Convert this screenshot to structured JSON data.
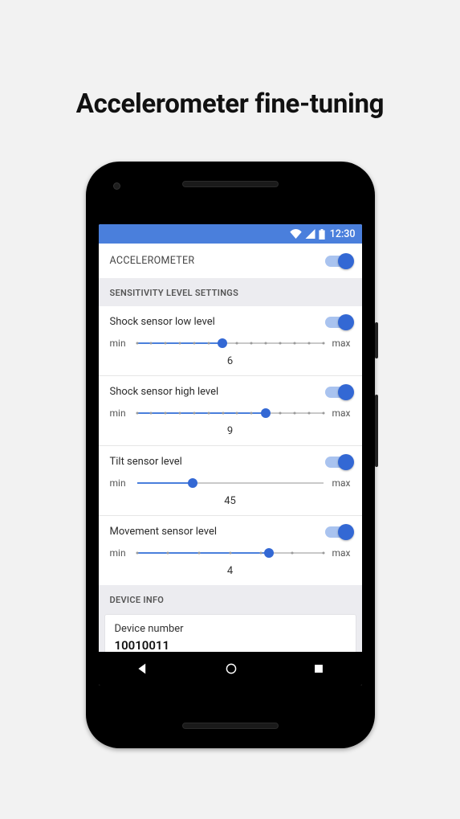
{
  "page": {
    "title": "Accelerometer fine-tuning"
  },
  "status": {
    "time": "12:30"
  },
  "master": {
    "label": "ACCELEROMETER",
    "on": true
  },
  "section_sensitivity": {
    "header": "SENSITIVITY LEVEL SETTINGS"
  },
  "labels": {
    "min": "min",
    "max": "max"
  },
  "settings": [
    {
      "title": "Shock sensor low level",
      "on": true,
      "value": 6,
      "min": 0,
      "max": 13,
      "ticks": true,
      "percent": 46
    },
    {
      "title": "Shock sensor high level",
      "on": true,
      "value": 9,
      "min": 0,
      "max": 13,
      "ticks": true,
      "percent": 69
    },
    {
      "title": "Tilt sensor level",
      "on": true,
      "value": 45,
      "min": 0,
      "max": 180,
      "ticks": false,
      "percent": 30
    },
    {
      "title": "Movement sensor level",
      "on": true,
      "value": 4,
      "min": 0,
      "max": 6,
      "ticks": true,
      "percent": 71
    }
  ],
  "device_info": {
    "header": "DEVICE INFO",
    "number_label": "Device number",
    "number_value": "10010011"
  }
}
